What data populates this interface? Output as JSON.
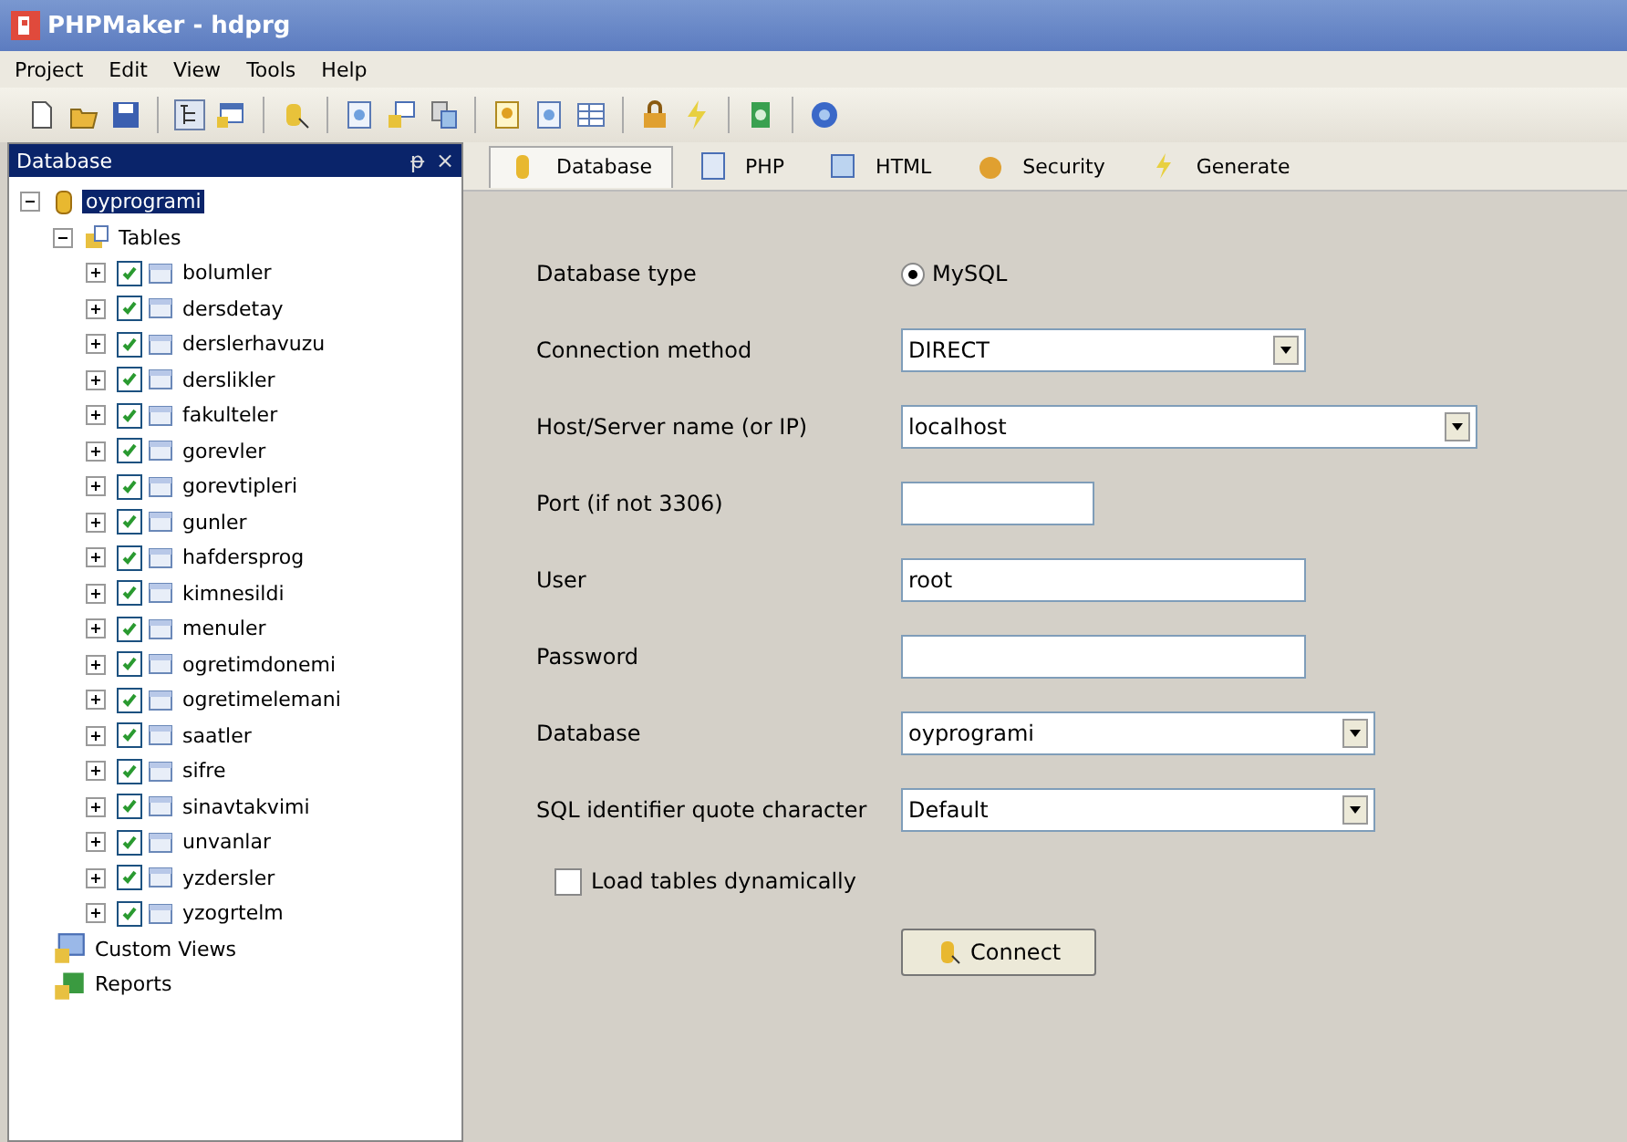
{
  "window": {
    "title": "PHPMaker - hdprg"
  },
  "menu": [
    "Project",
    "Edit",
    "View",
    "Tools",
    "Help"
  ],
  "panel": {
    "title": "Database",
    "pin": "ᵽ",
    "close": "×"
  },
  "tree": [
    {
      "label": "oyprogrami",
      "kind": "database",
      "selected": true,
      "expanded": true,
      "children": [
        {
          "label": "Tables",
          "kind": "folder",
          "selected": false,
          "expanded": true,
          "children": [
            {
              "label": "bolumler",
              "kind": "table",
              "checked": true,
              "expanded": false
            },
            {
              "label": "dersdetay",
              "kind": "table",
              "checked": true,
              "expanded": false
            },
            {
              "label": "derslerhavuzu",
              "kind": "table",
              "checked": true,
              "expanded": false
            },
            {
              "label": "derslikler",
              "kind": "table",
              "checked": true,
              "expanded": false
            },
            {
              "label": "fakulteler",
              "kind": "table",
              "checked": true,
              "expanded": false
            },
            {
              "label": "gorevler",
              "kind": "table",
              "checked": true,
              "expanded": false
            },
            {
              "label": "gorevtipleri",
              "kind": "table",
              "checked": true,
              "expanded": false
            },
            {
              "label": "gunler",
              "kind": "table",
              "checked": true,
              "expanded": false
            },
            {
              "label": "hafdersprog",
              "kind": "table",
              "checked": true,
              "expanded": false
            },
            {
              "label": "kimnesildi",
              "kind": "table",
              "checked": true,
              "expanded": false
            },
            {
              "label": "menuler",
              "kind": "table",
              "checked": true,
              "expanded": false
            },
            {
              "label": "ogretimdonemi",
              "kind": "table",
              "checked": true,
              "expanded": false
            },
            {
              "label": "ogretimelemani",
              "kind": "table",
              "checked": true,
              "expanded": false
            },
            {
              "label": "saatler",
              "kind": "table",
              "checked": true,
              "expanded": false
            },
            {
              "label": "sifre",
              "kind": "table",
              "checked": true,
              "expanded": false
            },
            {
              "label": "sinavtakvimi",
              "kind": "table",
              "checked": true,
              "expanded": false
            },
            {
              "label": "unvanlar",
              "kind": "table",
              "checked": true,
              "expanded": false
            },
            {
              "label": "yzdersler",
              "kind": "table",
              "checked": true,
              "expanded": false
            },
            {
              "label": "yzogrtelm",
              "kind": "table",
              "checked": true,
              "expanded": false
            }
          ]
        },
        {
          "label": "Custom Views",
          "kind": "views",
          "selected": false
        },
        {
          "label": "Reports",
          "kind": "reports",
          "selected": false
        }
      ]
    }
  ],
  "tabs": [
    {
      "label": "Database",
      "selected": true
    },
    {
      "label": "PHP",
      "selected": false
    },
    {
      "label": "HTML",
      "selected": false
    },
    {
      "label": "Security",
      "selected": false
    },
    {
      "label": "Generate",
      "selected": false
    }
  ],
  "form": [
    {
      "kind": "radio",
      "label": "Database type",
      "option": "MySQL",
      "checked": true
    },
    {
      "kind": "combo",
      "label": "Connection method",
      "value": "DIRECT"
    },
    {
      "kind": "combo",
      "label": "Host/Server name (or IP)",
      "value": "localhost"
    },
    {
      "kind": "text",
      "label": "Port (if not 3306)"
    },
    {
      "kind": "text",
      "label": "User",
      "value": "root"
    },
    {
      "kind": "text",
      "label": "Password"
    },
    {
      "kind": "combo",
      "label": "Database",
      "value": "oyprogrami"
    },
    {
      "kind": "combo",
      "label": "SQL identifier quote character",
      "value": "Default"
    },
    {
      "kind": "checkbox",
      "label": "Load tables dynamically",
      "checked": false
    }
  ],
  "connect_button": "Connect"
}
